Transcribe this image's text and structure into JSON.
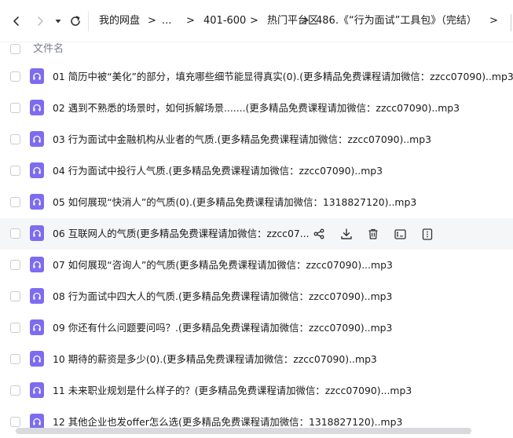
{
  "breadcrumb": {
    "items": [
      "我的网盘",
      "...",
      "401-600",
      "热门平台区",
      "486.《“行为面试”工具包》（完结）"
    ],
    "separator": ">"
  },
  "list": {
    "column_header": "文件名",
    "files": [
      {
        "name": "01 简历中被“美化”的部分，填充哪些细节能显得真实(0).(更多精品免费课程请加微信：zzcc07090)..mp3"
      },
      {
        "name": "02 遇到不熟悉的场景时，如何拆解场景.......(更多精品免费课程请加微信：zzcc07090)..mp3"
      },
      {
        "name": "03 行为面试中金融机构从业者的气质.(更多精品免费课程请加微信：zzcc07090)..mp3"
      },
      {
        "name": "04 行为面试中投行人气质.(更多精品免费课程请加微信：zzcc07090)..mp3"
      },
      {
        "name": "05 如何展现“快消人”的气质(0).(更多精品免费课程请加微信：1318827120)..mp3"
      },
      {
        "name": "06 互联网人的气质(更多精品免费课程请加微信：zzcc07..."
      },
      {
        "name": "07 如何展现“咨询人”的气质(更多精品免费课程请加微信：zzcc07090)...mp3"
      },
      {
        "name": "08 行为面试中四大人的气质.(更多精品免费课程请加微信：zzcc07090)..mp3"
      },
      {
        "name": "09 你还有什么问题要问吗？.(更多精品免费课程请加微信：zzcc07090)..mp3"
      },
      {
        "name": "10 期待的薪资是多少(0).(更多精品免费课程请加微信：zzcc07090)..mp3"
      },
      {
        "name": "11 未来职业规划是什么样子的？(更多精品免费课程请加微信：zzcc07090)...mp3"
      },
      {
        "name": "12 其他企业也发offer怎么选(更多精品免费课程请加微信：1318827120)..mp3"
      }
    ],
    "hovered_row": 5
  },
  "row_actions": [
    "share-icon",
    "download-icon",
    "delete-icon",
    "rename-icon",
    "more-icon"
  ],
  "colors": {
    "file_icon": "#7d6cf0",
    "hover_bg": "#f5f6f8"
  }
}
